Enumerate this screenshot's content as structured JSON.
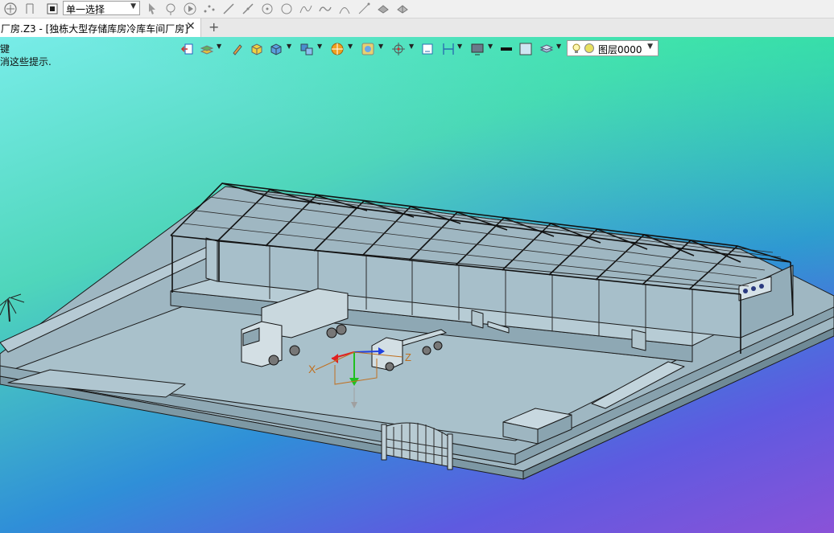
{
  "toolbar": {
    "select_mode": "单一选择",
    "icons": [
      "select-arrow-icon",
      "rotate-view-icon",
      "stop-icon",
      "pointer-icon",
      "lasso-icon",
      "play-icon",
      "points-icon",
      "line-icon",
      "polyline-icon",
      "circle-point-icon",
      "circle-icon",
      "curve-icon",
      "wave-icon",
      "arc-icon",
      "spline-icon",
      "cloud-icon",
      "cloud2-icon"
    ]
  },
  "tabs": {
    "active_title": "厂房.Z3 - [独栋大型存储库房冷库车间厂房]",
    "close_glyph": "✕",
    "add_glyph": "+"
  },
  "viewport": {
    "hint_line1": "键",
    "hint_line2": "消这些提示.",
    "layer_label": "图层0000",
    "axis_label_x": "X",
    "axis_label_z": "Z",
    "colors": {
      "model_fill": "#9fb7c2",
      "model_line": "#1a1a1a",
      "axis_x": "#e02020",
      "axis_y": "#20c020",
      "axis_z": "#2040e0"
    }
  },
  "float_toolbar": {
    "icons": [
      "exit-icon",
      "layer-stack-icon",
      "pencil-icon",
      "cube-yellow-icon",
      "cube-blue-icon",
      "cube-multi-icon",
      "render-icon",
      "view-icon",
      "snap-icon",
      "frame-icon",
      "dimension-icon",
      "monitor-icon",
      "line-weight-icon",
      "color-swatch-icon",
      "layers-icon",
      "bulb-icon",
      "circle-icon"
    ]
  }
}
